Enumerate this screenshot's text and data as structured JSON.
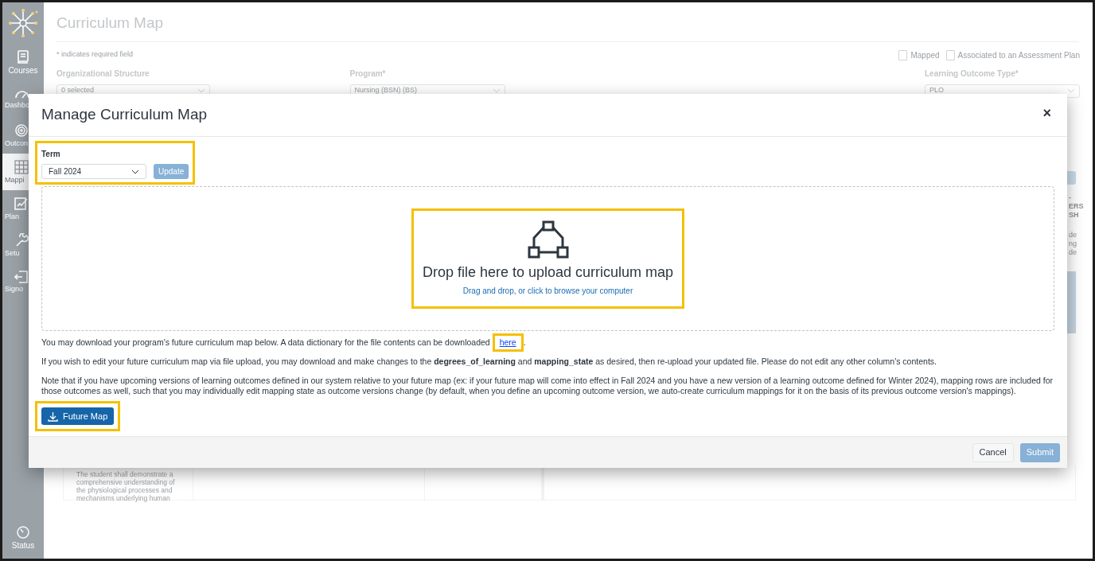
{
  "sidebar": {
    "items": [
      {
        "label": "Courses",
        "selected": false
      },
      {
        "label": "Dashbo",
        "selected": false
      },
      {
        "label": "Outcon",
        "selected": false
      },
      {
        "label": "Mappi",
        "selected": true
      },
      {
        "label": "Plan",
        "selected": false
      },
      {
        "label": "Setu",
        "selected": false
      },
      {
        "label": "Signo",
        "selected": false
      }
    ],
    "footer_item": {
      "label": "Status"
    }
  },
  "page": {
    "title": "Curriculum Map",
    "note": "* indicates required field",
    "legend": [
      "Mapped",
      "Associated to an Assessment Plan"
    ],
    "filters": [
      {
        "label": "Organizational Structure",
        "value": "0 selected"
      },
      {
        "label": "Program*",
        "value": "Nursing (BSN) (BS)"
      },
      {
        "label": "Learning Outcome Type*",
        "value": "PLO"
      }
    ],
    "right_fragments": [
      "-",
      "ERS",
      "SH",
      "de",
      "ng",
      "de"
    ],
    "table_cell": "The student shall demonstrate a comprehensive understanding of the physiological processes and mechanisms underlying human"
  },
  "modal": {
    "title": "Manage Curriculum Map",
    "close": "×",
    "term": {
      "label": "Term",
      "value": "Fall 2024"
    },
    "update_button": {
      "label": "Update",
      "disabled": true
    },
    "dropzone": {
      "title": "Drop file here to upload curriculum map",
      "subtitle": "Drag and drop, or click to browse your computer"
    },
    "download_text": {
      "before": "You may download your program's future curriculum map below. A data dictionary for the file contents can be downloaded ",
      "link": "here",
      "after": "."
    },
    "paragraphs": [
      "If you wish to edit your future curriculum map via file upload, you may download and make changes to the **degrees_of_learning** and **mapping_state** as desired, then re-upload your updated file. Please do not edit any other column's contents.",
      "Note that if you have upcoming versions of learning outcomes defined in our system relative to your future map (ex: if your future map will come into effect in Fall 2024 and you have a new version of a learning outcome defined for Winter 2024), mapping rows are included for those outcomes as well, such that you may individually edit mapping state as outcome versions change (by default, when you define an upcoming outcome version, we auto-create curriculum mappings for it on the basis of its previous outcome version's mappings)."
    ],
    "download_button": "Future Map",
    "footer_buttons": [
      {
        "label": "Cancel",
        "kind": "secondary",
        "disabled": false
      },
      {
        "label": "Submit",
        "kind": "primary",
        "disabled": true
      }
    ]
  }
}
